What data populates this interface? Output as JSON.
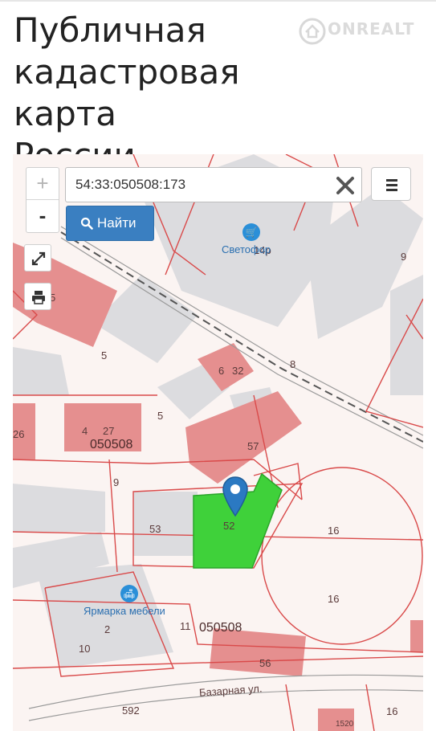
{
  "page": {
    "title_lines": [
      "Публичная",
      "кадастровая карта",
      "России"
    ],
    "watermark": "ONREALT"
  },
  "map": {
    "search": {
      "value": "54:33:050508:173",
      "placeholder": ""
    },
    "find_button": {
      "label": "Найти",
      "icon": "search-icon"
    },
    "zoom": {
      "in_label": "+",
      "out_label": "-"
    },
    "tools": [
      "fullscreen-icon",
      "print-icon"
    ],
    "menu_icon": "hamburger-icon",
    "clear_icon": "close-icon",
    "parcel_color": "#3fd13a",
    "building_color": "#e88a8a",
    "labels": {
      "l1": "14р",
      "l2": "9",
      "l3": "5",
      "l4": "5",
      "l5": "32",
      "l6": "6",
      "l7": "8",
      "l8": "26",
      "l9": "4",
      "l10": "27",
      "l11": "050508",
      "l12": "57",
      "l13": "9",
      "l14": "53",
      "l15": "52",
      "l16": "16",
      "l17": "16",
      "l18": "2",
      "l19": "11",
      "l20": "050508",
      "l21": "10",
      "l22": "56",
      "l23": "592",
      "l24": "Базарная ул.",
      "l25": "16",
      "l26": "1520",
      "l27": "5"
    },
    "pois": {
      "shop": "Светофор",
      "furniture": "Ярмарка мебели"
    }
  }
}
